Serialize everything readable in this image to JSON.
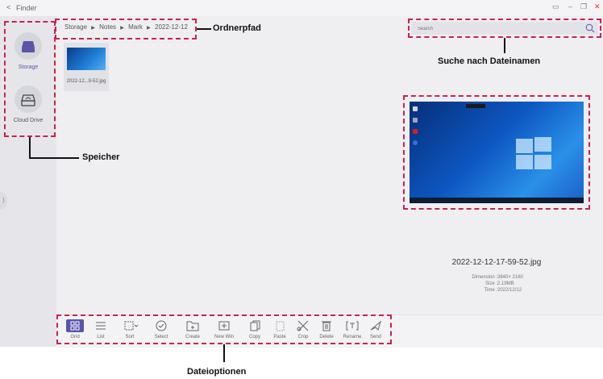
{
  "titlebar": {
    "back_icon": "chevron-left",
    "title": "Finder"
  },
  "sidebar": {
    "items": [
      {
        "icon": "hard-drive-icon",
        "label": "Storage",
        "active": true
      },
      {
        "icon": "cloud-drive-icon",
        "label": "Cloud Drive",
        "active": false
      }
    ],
    "collapse_glyph": "⟩"
  },
  "breadcrumb": [
    "Storage",
    "Notes",
    "Mark",
    "2022-12-12"
  ],
  "breadcrumb_separator": "▶",
  "search": {
    "placeholder": "Search"
  },
  "files": [
    {
      "name": "2022-12...9-52.jpg"
    }
  ],
  "preview": {
    "filename": "2022-12-12-17-59-52.jpg",
    "dimension_label": "Dimension :",
    "dimension": "3840× 2160",
    "size_label": "Size :",
    "size": "2.19MB",
    "time_label": "Time :",
    "time": "2022/12/12"
  },
  "toolbar": {
    "tools": [
      {
        "label": "Grid",
        "icon": "grid-icon",
        "active": true
      },
      {
        "label": "List",
        "icon": "list-icon",
        "active": false
      },
      {
        "label": "Sort",
        "icon": "sort-icon",
        "active": false
      },
      {
        "label": "Select",
        "icon": "select-icon",
        "active": false
      },
      {
        "label": "Create",
        "icon": "create-folder-icon",
        "active": false
      },
      {
        "label": "New Win",
        "icon": "new-window-icon",
        "active": false
      },
      {
        "label": "Copy",
        "icon": "copy-icon",
        "active": false
      },
      {
        "label": "Paste",
        "icon": "paste-icon",
        "active": false
      },
      {
        "label": "Crop",
        "icon": "crop-icon",
        "active": false
      },
      {
        "label": "Delete",
        "icon": "delete-icon",
        "active": false
      },
      {
        "label": "Rename",
        "icon": "rename-icon",
        "active": false
      },
      {
        "label": "Send",
        "icon": "send-icon",
        "active": false
      }
    ]
  },
  "annotations": {
    "path": "Ordnerpfad",
    "search": "Suche nach Dateinamen",
    "storage": "Speicher",
    "options": "Dateioptionen"
  },
  "colors": {
    "accent": "#5a55a8",
    "annotation_border": "#c9234d"
  }
}
